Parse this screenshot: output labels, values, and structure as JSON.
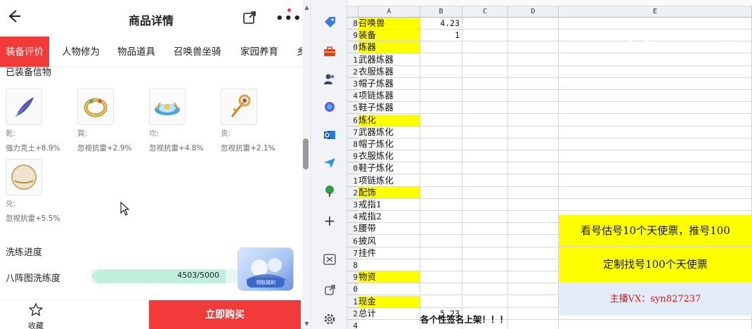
{
  "phone": {
    "header": {
      "title": "商品详情"
    },
    "tabs": [
      "装备评价",
      "人物修为",
      "物品道具",
      "召唤兽坐骑",
      "家园养育",
      "乡"
    ],
    "equipped_section": "已装备信物",
    "items": [
      {
        "key": "乾:",
        "effect": "强力克土+8.9%",
        "icon": "feather-icon",
        "color": "#3a7a9c"
      },
      {
        "key": "巽:",
        "effect": "忽视抗雷+2.9%",
        "icon": "ring-icon",
        "color": "#c99a2e"
      },
      {
        "key": "坎:",
        "effect": "忽视抗雷+4.8%",
        "icon": "crown-icon",
        "color": "#3b8fd0"
      },
      {
        "key": "贵:",
        "effect": "忽视抗雷+2.1%",
        "icon": "scepter-icon",
        "color": "#d08a2c"
      },
      {
        "key": "兑:",
        "effect": "忽视抗雷+5.5%",
        "icon": "orb-icon",
        "color": "#e8d9b8"
      }
    ],
    "refine_section": "洗练进度",
    "progress": {
      "label": "八阵图洗练度",
      "text": "4503/5000",
      "current": 4503,
      "max": 5000
    },
    "promo_badge": "领取福利",
    "bottom": {
      "favorite": "收藏",
      "buy": "立即购买"
    }
  },
  "sheet": {
    "columns": [
      "A",
      "B",
      "C",
      "D",
      "E"
    ],
    "rows": [
      {
        "num": "8",
        "a": "召唤兽",
        "b": "4.23",
        "yellow": true
      },
      {
        "num": "9",
        "a": "装备",
        "b": "1",
        "yellow": true
      },
      {
        "num": "0",
        "a": "炼器",
        "b": "",
        "yellow": true
      },
      {
        "num": "1",
        "a": "武器炼器",
        "b": "",
        "yellow": false
      },
      {
        "num": "2",
        "a": "衣服炼器",
        "b": "",
        "yellow": false
      },
      {
        "num": "3",
        "a": "帽子炼器",
        "b": "",
        "yellow": false
      },
      {
        "num": "4",
        "a": "项链炼器",
        "b": "",
        "yellow": false
      },
      {
        "num": "5",
        "a": "鞋子炼器",
        "b": "",
        "yellow": false
      },
      {
        "num": "6",
        "a": "炼化",
        "b": "",
        "yellow": true
      },
      {
        "num": "7",
        "a": "武器炼化",
        "b": "",
        "yellow": false
      },
      {
        "num": "8",
        "a": "帽子炼化",
        "b": "",
        "yellow": false
      },
      {
        "num": "9",
        "a": "衣服炼化",
        "b": "",
        "yellow": false
      },
      {
        "num": "0",
        "a": "鞋子炼化",
        "b": "",
        "yellow": false
      },
      {
        "num": "1",
        "a": "项链炼化",
        "b": "",
        "yellow": false
      },
      {
        "num": "2",
        "a": "配饰",
        "b": "",
        "yellow": true
      },
      {
        "num": "3",
        "a": "戒指1",
        "b": "",
        "yellow": false
      },
      {
        "num": "4",
        "a": "戒指2",
        "b": "",
        "yellow": false
      },
      {
        "num": "5",
        "a": "腰带",
        "b": "",
        "yellow": false
      },
      {
        "num": "6",
        "a": "披风",
        "b": "",
        "yellow": false
      },
      {
        "num": "7",
        "a": "挂件",
        "b": "",
        "yellow": false
      },
      {
        "num": "8",
        "a": "",
        "b": "",
        "yellow": false
      },
      {
        "num": "9",
        "a": "物资",
        "b": "",
        "yellow": true
      },
      {
        "num": "0",
        "a": "",
        "b": "",
        "yellow": false
      },
      {
        "num": "1",
        "a": "现金",
        "b": "",
        "yellow": true
      },
      {
        "num": "2",
        "a": "总计",
        "b": "5.23",
        "yellow": false
      },
      {
        "num": "4",
        "a": "",
        "b": "",
        "yellow": false
      }
    ],
    "footer_text": "各个性签名上架！！！",
    "e_messages": {
      "line1": "看号估号10个天使票，推号100",
      "line2": "定制找号100个天使票",
      "line3": "主播VX：syn827237"
    },
    "colors": {
      "yellow": "#ffff00",
      "red_text": "#d01b1b",
      "blue_bg": "#e4ecf7"
    }
  },
  "strip_icons": [
    "tag-icon",
    "toolbox-icon",
    "people-icon",
    "copilot-icon",
    "outlook-icon",
    "send-icon",
    "tree-icon",
    "plus-icon",
    "split-screen-icon",
    "external-link-icon",
    "settings-icon"
  ]
}
